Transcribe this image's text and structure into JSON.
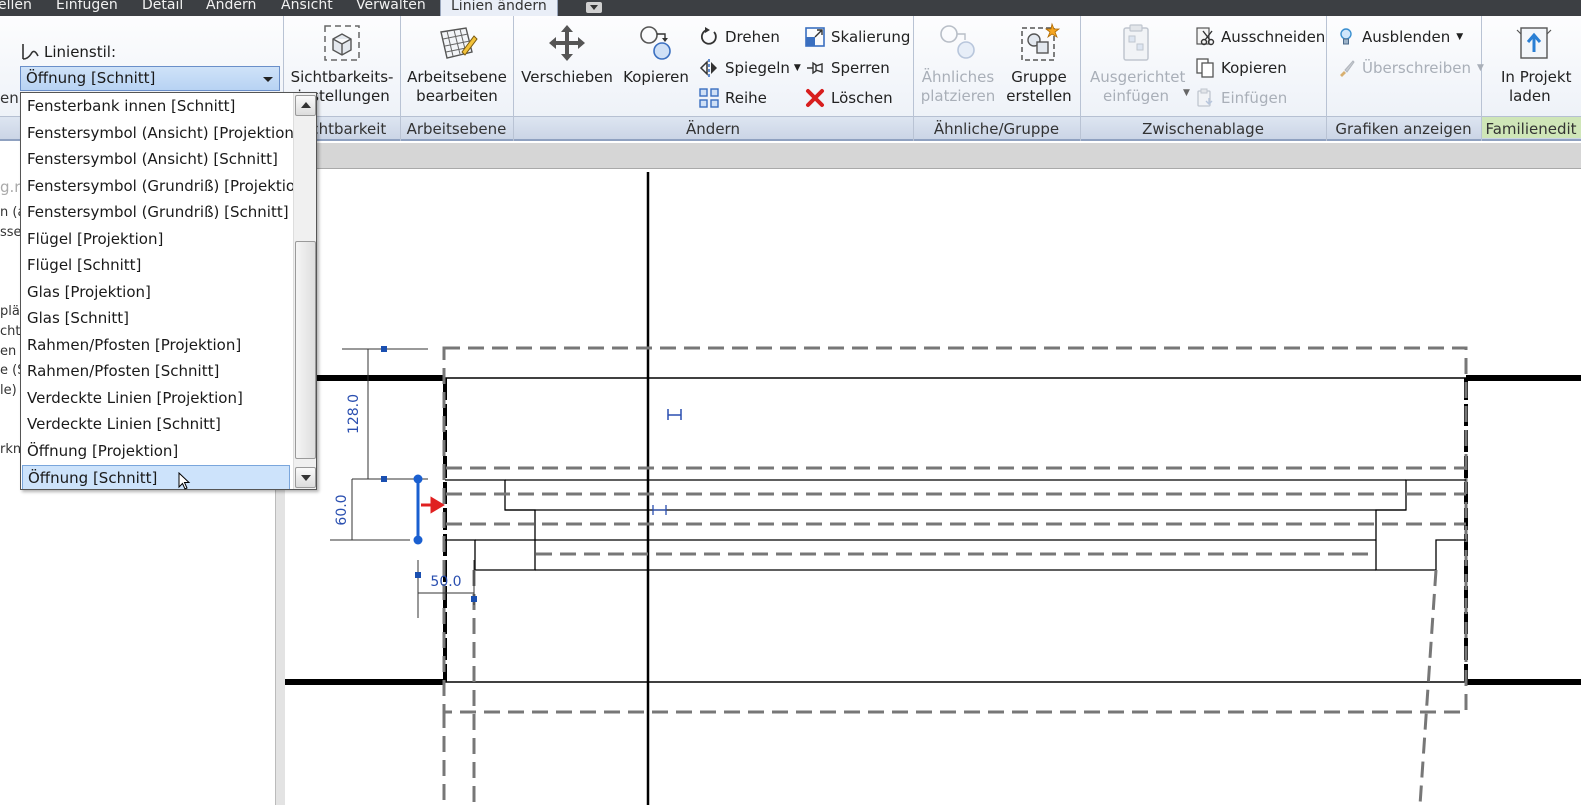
{
  "menubar": {
    "items": [
      "ellen",
      "Einfügen",
      "Detail",
      "Ändern",
      "Ansicht",
      "Verwalten",
      "Linien ändern"
    ],
    "active_index": 6
  },
  "linestyle": {
    "label": "Linienstil:",
    "selected": "Öffnung [Schnitt]",
    "options": [
      "Fensterbank innen [Schnitt]",
      "Fenstersymbol (Ansicht) [Projektion]",
      "Fenstersymbol (Ansicht) [Schnitt]",
      "Fenstersymbol (Grundriß) [Projektion]",
      "Fenstersymbol (Grundriß) [Schnitt]",
      "Flügel [Projektion]",
      "Flügel [Schnitt]",
      "Glas [Projektion]",
      "Glas [Schnitt]",
      "Rahmen/Pfosten [Projektion]",
      "Rahmen/Pfosten [Schnitt]",
      "Verdeckte Linien [Projektion]",
      "Verdeckte Linien [Schnitt]",
      "Öffnung [Projektion]",
      "Öffnung [Schnitt]"
    ],
    "highlighted_index": 14
  },
  "ribbon": {
    "left_fragment": "en",
    "visibility": {
      "button": [
        "Sichtbarkeits-",
        "einstellungen"
      ],
      "panel": "Sichtbarkeit"
    },
    "workplane": {
      "button": [
        "Arbeitsebene",
        "bearbeiten"
      ],
      "panel": "Arbeitsebene"
    },
    "modify": {
      "panel": "Ändern",
      "move": "Verschieben",
      "copy": "Kopieren",
      "rotate": "Drehen",
      "mirror": "Spiegeln",
      "array": "Reihe",
      "scale": "Skalierung",
      "pin": "Sperren",
      "delete": "Löschen"
    },
    "similar": {
      "panel": "Ähnliche/Gruppe",
      "place_similar": [
        "Ähnliches",
        "platzieren"
      ],
      "create_group": [
        "Gruppe",
        "erstellen"
      ]
    },
    "clipboard": {
      "panel": "Zwischenablage",
      "paste_aligned": [
        "Ausgerichtet",
        "einfügen"
      ],
      "cut": "Ausschneiden",
      "copy": "Kopieren",
      "paste": "Einfügen"
    },
    "graphics": {
      "panel": "Grafiken anzeigen",
      "hide": "Ausblenden",
      "override": "Überschreiben"
    },
    "family": {
      "panel": "Familienedit",
      "load": [
        "In Projekt",
        "laden"
      ]
    }
  },
  "left_fragments": [
    "g.r",
    "n (a",
    "sse",
    "plän",
    "chte",
    "en (A",
    "e (Sc",
    "le)",
    "rknü"
  ],
  "dimensions": {
    "height_upper": "128.0",
    "height_lower": "60.0",
    "width": "50.0"
  },
  "colors": {
    "selection_blue": "#1a5fd0",
    "arrow_red": "#e02020",
    "dim_blue": "#2a4fb0",
    "delete_red": "#d81e1e"
  }
}
